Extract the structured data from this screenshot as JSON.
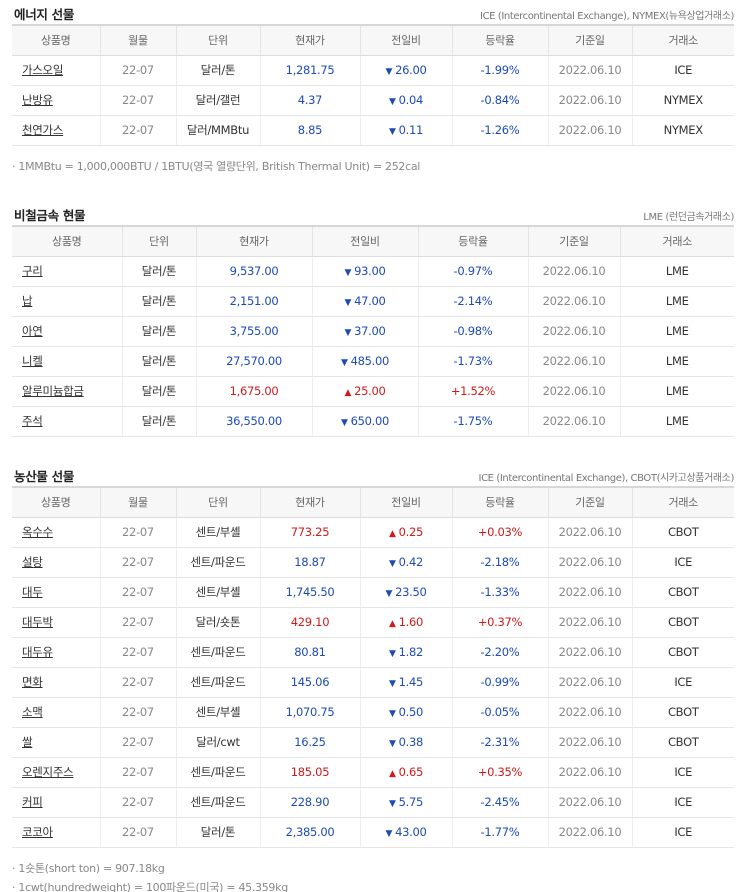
{
  "energy": {
    "title": "에너지 선물",
    "source": "ICE (Intercontinental Exchange), NYMEX(뉴욕상업거래소)",
    "headers": [
      "상품명",
      "월물",
      "단위",
      "현재가",
      "전일비",
      "등락율",
      "기준일",
      "거래소"
    ],
    "rows": [
      {
        "name": "가스오일",
        "month": "22-07",
        "unit": "달러/톤",
        "price": "1,281.75",
        "dir": "down",
        "change": "26.00",
        "rate": "-1.99%",
        "date": "2022.06.10",
        "exchange": "ICE"
      },
      {
        "name": "난방유",
        "month": "22-07",
        "unit": "달러/갤런",
        "price": "4.37",
        "dir": "down",
        "change": "0.04",
        "rate": "-0.84%",
        "date": "2022.06.10",
        "exchange": "NYMEX"
      },
      {
        "name": "천연가스",
        "month": "22-07",
        "unit": "달러/MMBtu",
        "price": "8.85",
        "dir": "down",
        "change": "0.11",
        "rate": "-1.26%",
        "date": "2022.06.10",
        "exchange": "NYMEX"
      }
    ],
    "notes": [
      "· 1MMBtu = 1,000,000BTU / 1BTU(영국 열량단위, British Thermal Unit) = 252cal"
    ]
  },
  "metals": {
    "title": "비철금속 현물",
    "source": "LME (런던금속거래소)",
    "headers": [
      "상품명",
      "단위",
      "현재가",
      "전일비",
      "등락율",
      "기준일",
      "거래소"
    ],
    "rows": [
      {
        "name": "구리",
        "unit": "달러/톤",
        "price": "9,537.00",
        "dir": "down",
        "change": "93.00",
        "rate": "-0.97%",
        "date": "2022.06.10",
        "exchange": "LME"
      },
      {
        "name": "납",
        "unit": "달러/톤",
        "price": "2,151.00",
        "dir": "down",
        "change": "47.00",
        "rate": "-2.14%",
        "date": "2022.06.10",
        "exchange": "LME"
      },
      {
        "name": "아연",
        "unit": "달러/톤",
        "price": "3,755.00",
        "dir": "down",
        "change": "37.00",
        "rate": "-0.98%",
        "date": "2022.06.10",
        "exchange": "LME"
      },
      {
        "name": "니켈",
        "unit": "달러/톤",
        "price": "27,570.00",
        "dir": "down",
        "change": "485.00",
        "rate": "-1.73%",
        "date": "2022.06.10",
        "exchange": "LME"
      },
      {
        "name": "알루미늄합금",
        "unit": "달러/톤",
        "price": "1,675.00",
        "dir": "up",
        "change": "25.00",
        "rate": "+1.52%",
        "date": "2022.06.10",
        "exchange": "LME"
      },
      {
        "name": "주석",
        "unit": "달러/톤",
        "price": "36,550.00",
        "dir": "down",
        "change": "650.00",
        "rate": "-1.75%",
        "date": "2022.06.10",
        "exchange": "LME"
      }
    ]
  },
  "agri": {
    "title": "농산물 선물",
    "source": "ICE (Intercontinental Exchange), CBOT(시카고상품거래소)",
    "headers": [
      "상품명",
      "월물",
      "단위",
      "현재가",
      "전일비",
      "등락율",
      "기준일",
      "거래소"
    ],
    "rows": [
      {
        "name": "옥수수",
        "month": "22-07",
        "unit": "센트/부셸",
        "price": "773.25",
        "dir": "up",
        "change": "0.25",
        "rate": "+0.03%",
        "date": "2022.06.10",
        "exchange": "CBOT"
      },
      {
        "name": "설탕",
        "month": "22-07",
        "unit": "센트/파운드",
        "price": "18.87",
        "dir": "down",
        "change": "0.42",
        "rate": "-2.18%",
        "date": "2022.06.10",
        "exchange": "ICE"
      },
      {
        "name": "대두",
        "month": "22-07",
        "unit": "센트/부셸",
        "price": "1,745.50",
        "dir": "down",
        "change": "23.50",
        "rate": "-1.33%",
        "date": "2022.06.10",
        "exchange": "CBOT"
      },
      {
        "name": "대두박",
        "month": "22-07",
        "unit": "달러/숏톤",
        "price": "429.10",
        "dir": "up",
        "change": "1.60",
        "rate": "+0.37%",
        "date": "2022.06.10",
        "exchange": "CBOT"
      },
      {
        "name": "대두유",
        "month": "22-07",
        "unit": "센트/파운드",
        "price": "80.81",
        "dir": "down",
        "change": "1.82",
        "rate": "-2.20%",
        "date": "2022.06.10",
        "exchange": "CBOT"
      },
      {
        "name": "면화",
        "month": "22-07",
        "unit": "센트/파운드",
        "price": "145.06",
        "dir": "down",
        "change": "1.45",
        "rate": "-0.99%",
        "date": "2022.06.10",
        "exchange": "ICE"
      },
      {
        "name": "소맥",
        "month": "22-07",
        "unit": "센트/부셸",
        "price": "1,070.75",
        "dir": "down",
        "change": "0.50",
        "rate": "-0.05%",
        "date": "2022.06.10",
        "exchange": "CBOT"
      },
      {
        "name": "쌀",
        "month": "22-07",
        "unit": "달러/cwt",
        "price": "16.25",
        "dir": "down",
        "change": "0.38",
        "rate": "-2.31%",
        "date": "2022.06.10",
        "exchange": "CBOT"
      },
      {
        "name": "오렌지주스",
        "month": "22-07",
        "unit": "센트/파운드",
        "price": "185.05",
        "dir": "up",
        "change": "0.65",
        "rate": "+0.35%",
        "date": "2022.06.10",
        "exchange": "ICE"
      },
      {
        "name": "커피",
        "month": "22-07",
        "unit": "센트/파운드",
        "price": "228.90",
        "dir": "down",
        "change": "5.75",
        "rate": "-2.45%",
        "date": "2022.06.10",
        "exchange": "ICE"
      },
      {
        "name": "코코아",
        "month": "22-07",
        "unit": "달러/톤",
        "price": "2,385.00",
        "dir": "down",
        "change": "43.00",
        "rate": "-1.77%",
        "date": "2022.06.10",
        "exchange": "ICE"
      }
    ],
    "notes": [
      "· 1숏톤(short ton) = 907.18kg",
      "· 1cwt(hundredweight) = 100파운드(미국) = 45.359kg"
    ]
  },
  "symbols": {
    "up": "▲",
    "down": "▼"
  },
  "colors": {
    "up": "#d11a1a",
    "down": "#1e4bb5",
    "neutral": "#333333",
    "muted": "#888888"
  }
}
